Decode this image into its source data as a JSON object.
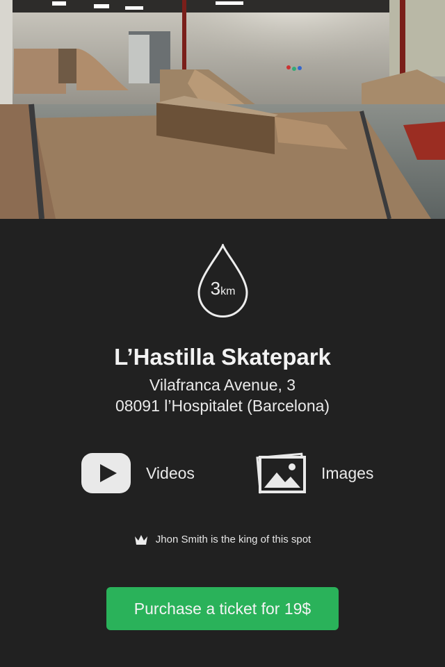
{
  "spot": {
    "distance_value": "3",
    "distance_unit": "km",
    "name": "L’Hastilla Skatepark",
    "address_line1": "Vilafranca Avenue, 3",
    "address_line2": "08091 l’Hospitalet (Barcelona)"
  },
  "media": {
    "videos_label": "Videos",
    "images_label": "Images"
  },
  "king": {
    "text": "Jhon Smith is the king of this spot",
    "icon": "crown-icon"
  },
  "purchase": {
    "label": "Purchase a ticket for 19$"
  },
  "colors": {
    "background": "#212121",
    "accent_green": "#2ab25a",
    "text": "#eaeaea"
  },
  "icons": [
    "distance-drop-icon",
    "play-icon",
    "picture-icon",
    "crown-icon"
  ]
}
